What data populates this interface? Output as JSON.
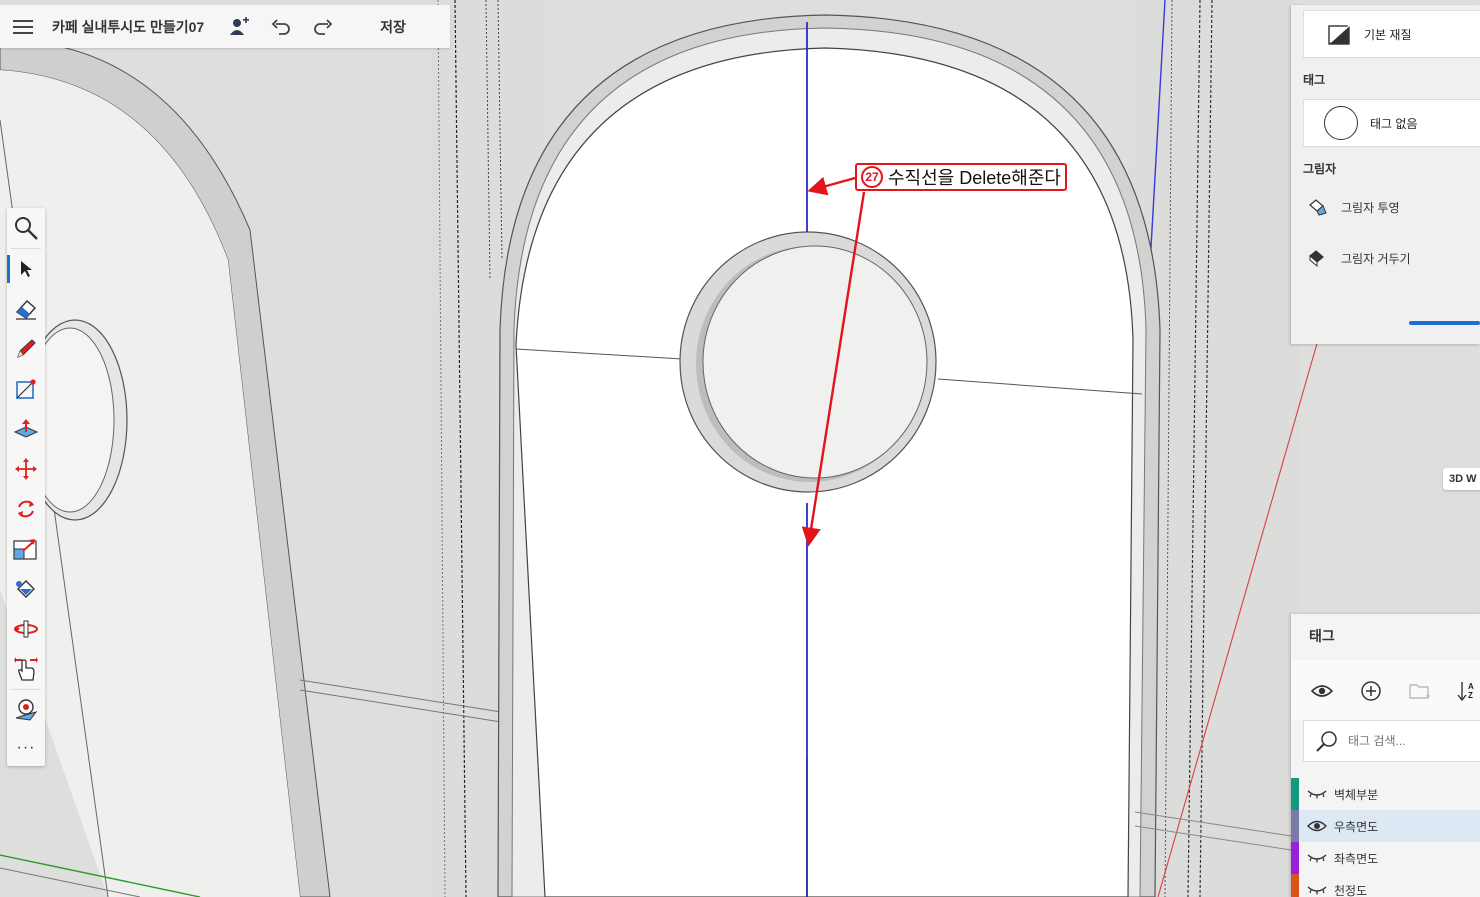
{
  "topbar": {
    "menu_icon": "hamburger-menu-icon",
    "title": "카페 실내투시도 만들기07",
    "share_icon": "add-person-icon",
    "undo_icon": "undo-icon",
    "redo_icon": "redo-icon",
    "save_label": "저장"
  },
  "toolbar": {
    "tools": [
      "search-icon",
      "select-arrow-icon",
      "eraser-icon",
      "pencil-icon",
      "rectangle-icon",
      "push-pull-icon",
      "move-icon",
      "rotate-icon",
      "scale-icon",
      "paint-bucket-icon",
      "orbit-icon",
      "pan-hand-icon",
      "position-camera-icon"
    ],
    "active_tool": "select-arrow-icon",
    "more_label": "···"
  },
  "properties": {
    "material_label": "기본 재질",
    "tag_heading": "태그",
    "tag_value": "태그 없음",
    "shadow_heading": "그림자",
    "cast_shadows_label": "그림자 투영",
    "receive_shadows_label": "그림자 거두기"
  },
  "warehouse_chip": "3D W",
  "tags_panel": {
    "title": "태그",
    "toolbar_icons": [
      "eye-icon",
      "add-tag-icon",
      "folder-icon",
      "sort-az-icon"
    ],
    "sort_label_top": "A",
    "sort_label_bottom": "Z",
    "search_placeholder": "태그 검색...",
    "rows": [
      {
        "name": "벽체부분",
        "visible": false,
        "color": "#14967f"
      },
      {
        "name": "우측면도",
        "visible": true,
        "color": "#7a7aa8"
      },
      {
        "name": "좌측면도",
        "visible": false,
        "color": "#9b1fd8"
      },
      {
        "name": "천정도",
        "visible": false,
        "color": "#d9541b"
      }
    ]
  },
  "annotation": {
    "number": "27",
    "text": "수직선을 Delete해준다",
    "color": "#e2141c"
  }
}
